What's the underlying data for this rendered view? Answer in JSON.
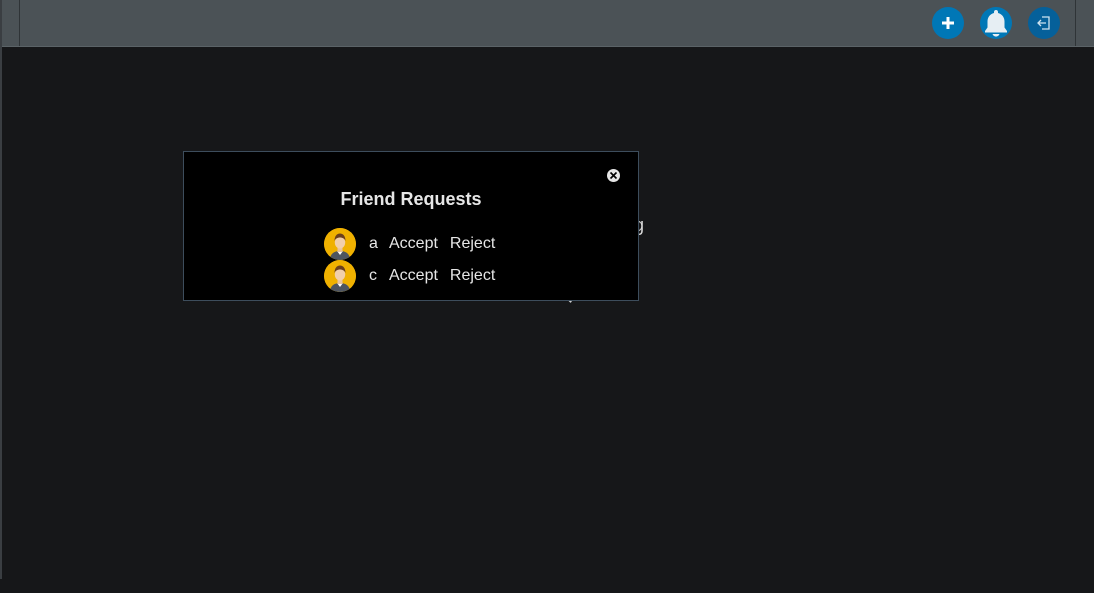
{
  "header": {
    "buttons": [
      {
        "icon": "plus-icon",
        "color": "#0077b6"
      },
      {
        "icon": "bell-icon",
        "color": "#0077b6"
      },
      {
        "icon": "logout-icon",
        "color": "#05609a"
      }
    ]
  },
  "background": {
    "partial_text": "aging"
  },
  "friend_requests": {
    "title": "Friend Requests",
    "close_icon": "close-icon",
    "requests": [
      {
        "name": "a",
        "accept_label": "Accept",
        "reject_label": "Reject",
        "avatar": "user-avatar-icon"
      },
      {
        "name": "c",
        "accept_label": "Accept",
        "reject_label": "Reject",
        "avatar": "user-avatar-icon"
      }
    ]
  },
  "colors": {
    "background": "#161719",
    "topbar": "#4b5256",
    "accent": "#0077b6",
    "modal_bg": "#000000",
    "avatar_bg": "#f0b100"
  }
}
